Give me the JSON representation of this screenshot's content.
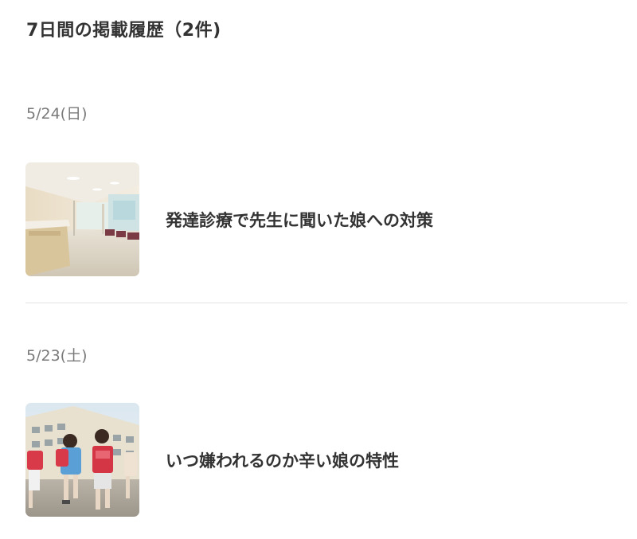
{
  "header": {
    "title": "7日間の掲載履歴（2件)"
  },
  "history": [
    {
      "date": "5/24(日)",
      "title": "発達診療で先生に聞いた娘への対策",
      "thumbnail": "hospital-corridor-photo"
    },
    {
      "date": "5/23(土)",
      "title": "いつ嫌われるのか辛い娘の特性",
      "thumbnail": "schoolchildren-photo"
    }
  ],
  "colors": {
    "text": "#333333",
    "date_text": "#7a7a7a",
    "divider": "#e3e3e3",
    "background": "#ffffff"
  }
}
